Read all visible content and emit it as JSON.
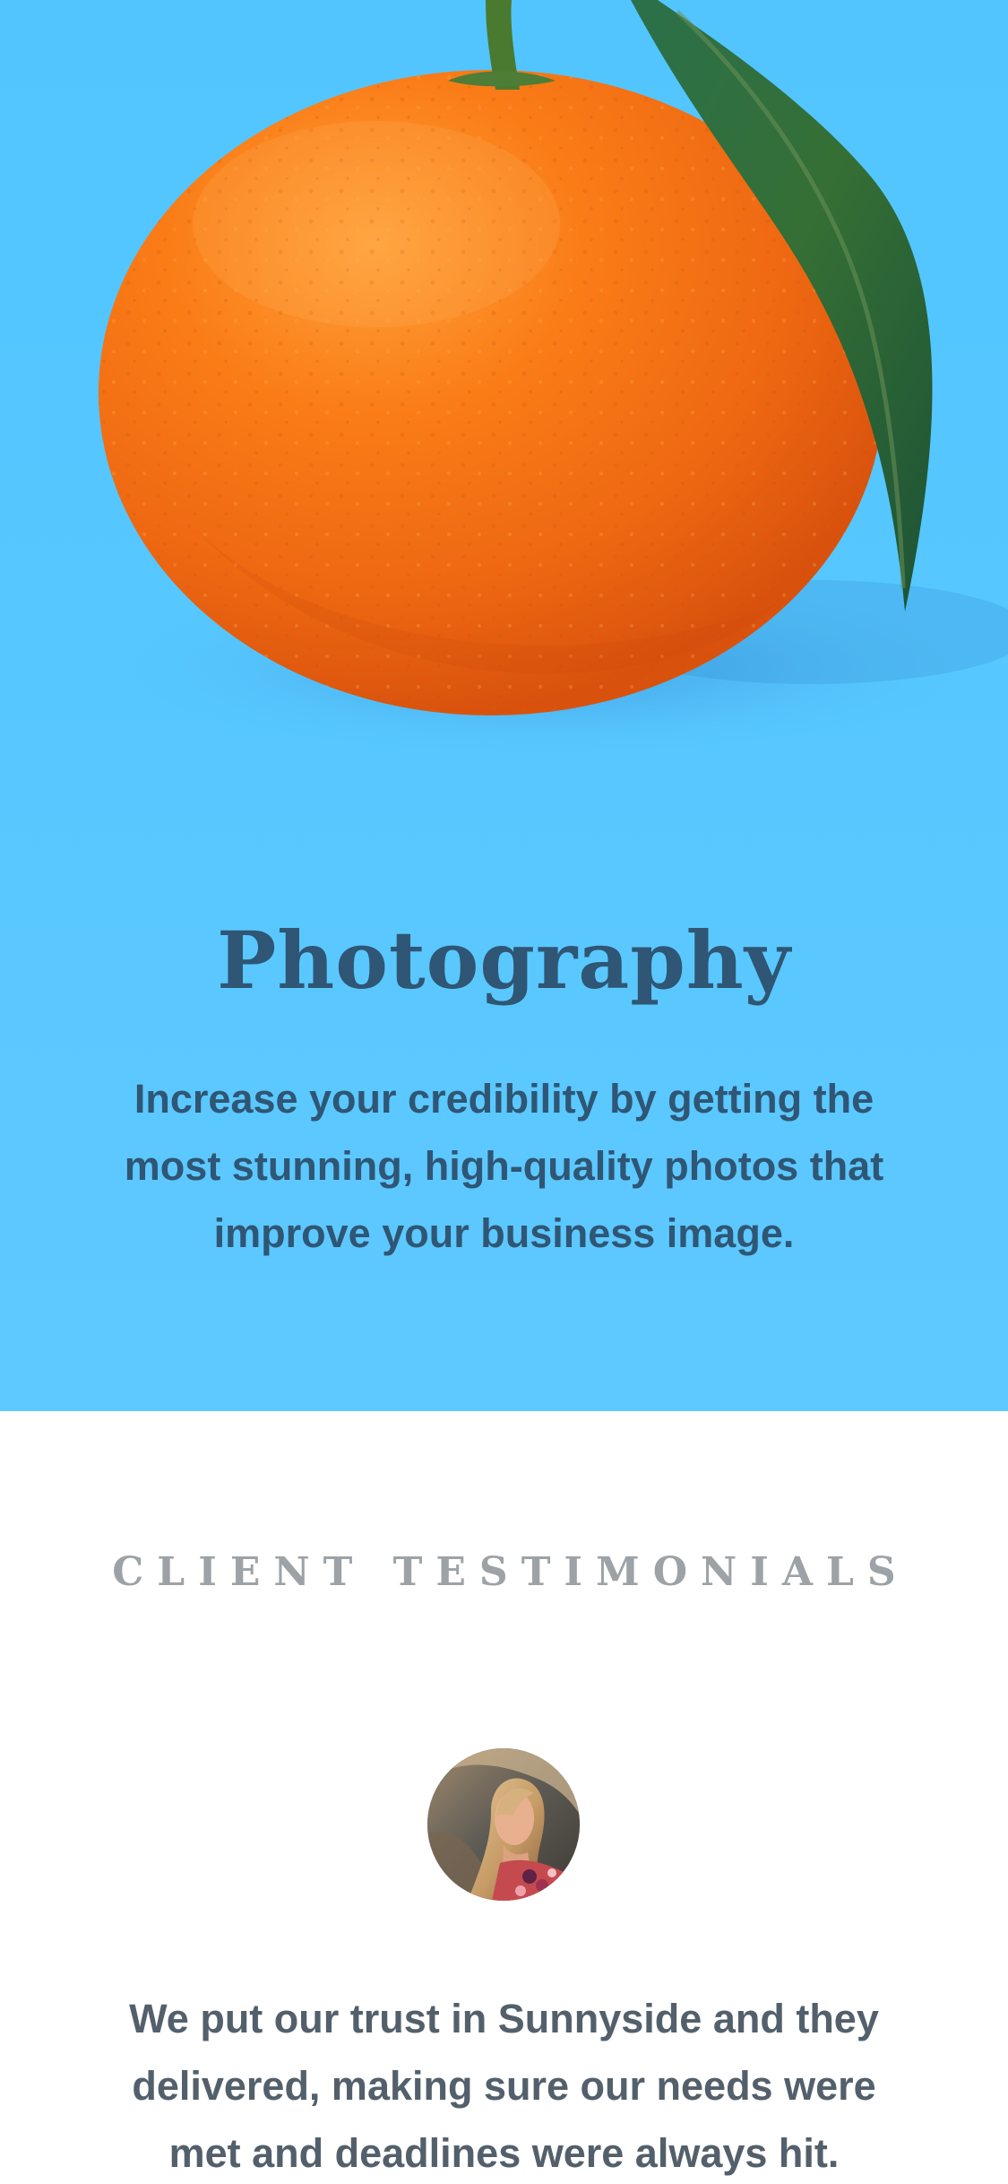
{
  "hero": {
    "image_icon": "orange-with-leaf-photo",
    "title": "Photography",
    "description": "Increase your credibility by getting the most stunning, high-quality photos that improve your business image."
  },
  "testimonials": {
    "heading": "CLIENT TESTIMONIALS",
    "avatar_icon": "client-avatar-photo",
    "quote": "We put our trust in Sunnyside and they delivered, making sure our needs were met and deadlines were always hit."
  },
  "colors": {
    "hero_background": "#57c7ff",
    "hero_text": "#2f5674",
    "heading_text": "#9da2a7",
    "quote_text": "#53606c",
    "orange": "#f57b16",
    "leaf": "#25663f"
  }
}
